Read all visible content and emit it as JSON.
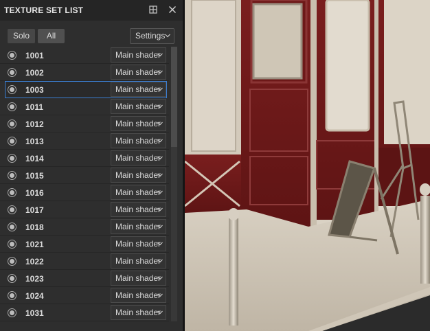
{
  "panel": {
    "title": "TEXTURE SET LIST",
    "header_icons": [
      "maximize-icon",
      "close-icon"
    ]
  },
  "toolbar": {
    "solo_label": "Solo",
    "all_label": "All",
    "settings_label": "Settings"
  },
  "texture_sets": [
    {
      "name": "1001",
      "shader": "Main shader",
      "selected": false
    },
    {
      "name": "1002",
      "shader": "Main shader",
      "selected": false
    },
    {
      "name": "1003",
      "shader": "Main shader",
      "selected": true
    },
    {
      "name": "1011",
      "shader": "Main shader",
      "selected": false
    },
    {
      "name": "1012",
      "shader": "Main shader",
      "selected": false
    },
    {
      "name": "1013",
      "shader": "Main shader",
      "selected": false
    },
    {
      "name": "1014",
      "shader": "Main shader",
      "selected": false
    },
    {
      "name": "1015",
      "shader": "Main shader",
      "selected": false
    },
    {
      "name": "1016",
      "shader": "Main shader",
      "selected": false
    },
    {
      "name": "1017",
      "shader": "Main shader",
      "selected": false
    },
    {
      "name": "1018",
      "shader": "Main shader",
      "selected": false
    },
    {
      "name": "1021",
      "shader": "Main shader",
      "selected": false
    },
    {
      "name": "1022",
      "shader": "Main shader",
      "selected": false
    },
    {
      "name": "1023",
      "shader": "Main shader",
      "selected": false
    },
    {
      "name": "1024",
      "shader": "Main shader",
      "selected": false
    },
    {
      "name": "1031",
      "shader": "Main shader",
      "selected": false
    }
  ],
  "colors": {
    "selection_outline": "#3b7fd4",
    "panel_bg": "#2e2e2e",
    "wall_red": "#7a1f1f",
    "wall_cream": "#d6cdbf"
  }
}
